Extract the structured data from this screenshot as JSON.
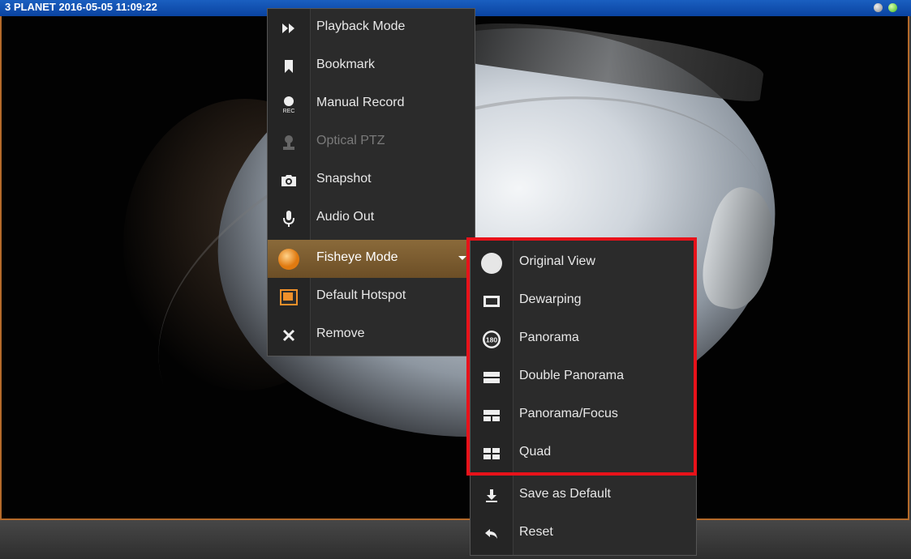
{
  "camera": {
    "title": "3 PLANET   2016-05-05 11:09:22"
  },
  "context_menu": {
    "items": [
      {
        "label": "Playback Mode",
        "icon": "fast-forward-icon",
        "state": "normal"
      },
      {
        "label": "Bookmark",
        "icon": "bookmark-icon",
        "state": "normal"
      },
      {
        "label": "Manual Record",
        "icon": "record-icon",
        "icon_text": "REC",
        "state": "normal"
      },
      {
        "label": "Optical PTZ",
        "icon": "joystick-icon",
        "state": "disabled"
      },
      {
        "label": "Snapshot",
        "icon": "camera-icon",
        "state": "normal"
      },
      {
        "label": "Audio Out",
        "icon": "microphone-icon",
        "state": "normal"
      },
      {
        "label": "Fisheye Mode",
        "icon": "fisheye-orb-icon",
        "state": "active"
      },
      {
        "label": "Default Hotspot",
        "icon": "hotspot-icon",
        "state": "normal"
      },
      {
        "label": "Remove",
        "icon": "close-icon",
        "state": "normal"
      }
    ]
  },
  "fisheye_submenu": {
    "items": [
      {
        "label": "Original View",
        "icon": "circle-view-icon"
      },
      {
        "label": "Dewarping",
        "icon": "dewarp-rect-icon"
      },
      {
        "label": "Panorama",
        "icon": "panorama-180-icon",
        "icon_text": "180"
      },
      {
        "label": "Double Panorama",
        "icon": "double-panorama-icon"
      },
      {
        "label": "Panorama/Focus",
        "icon": "panorama-focus-icon"
      },
      {
        "label": "Quad",
        "icon": "quad-icon"
      },
      {
        "label": "Save as Default",
        "icon": "download-icon"
      },
      {
        "label": "Reset",
        "icon": "reset-arrow-icon"
      }
    ]
  },
  "colors": {
    "title_bar": "#0a43a0",
    "frame_border": "#b46a2a",
    "active_item": "#7a5a30",
    "highlight_box": "#e8121a",
    "led_green": "#3cb818"
  }
}
